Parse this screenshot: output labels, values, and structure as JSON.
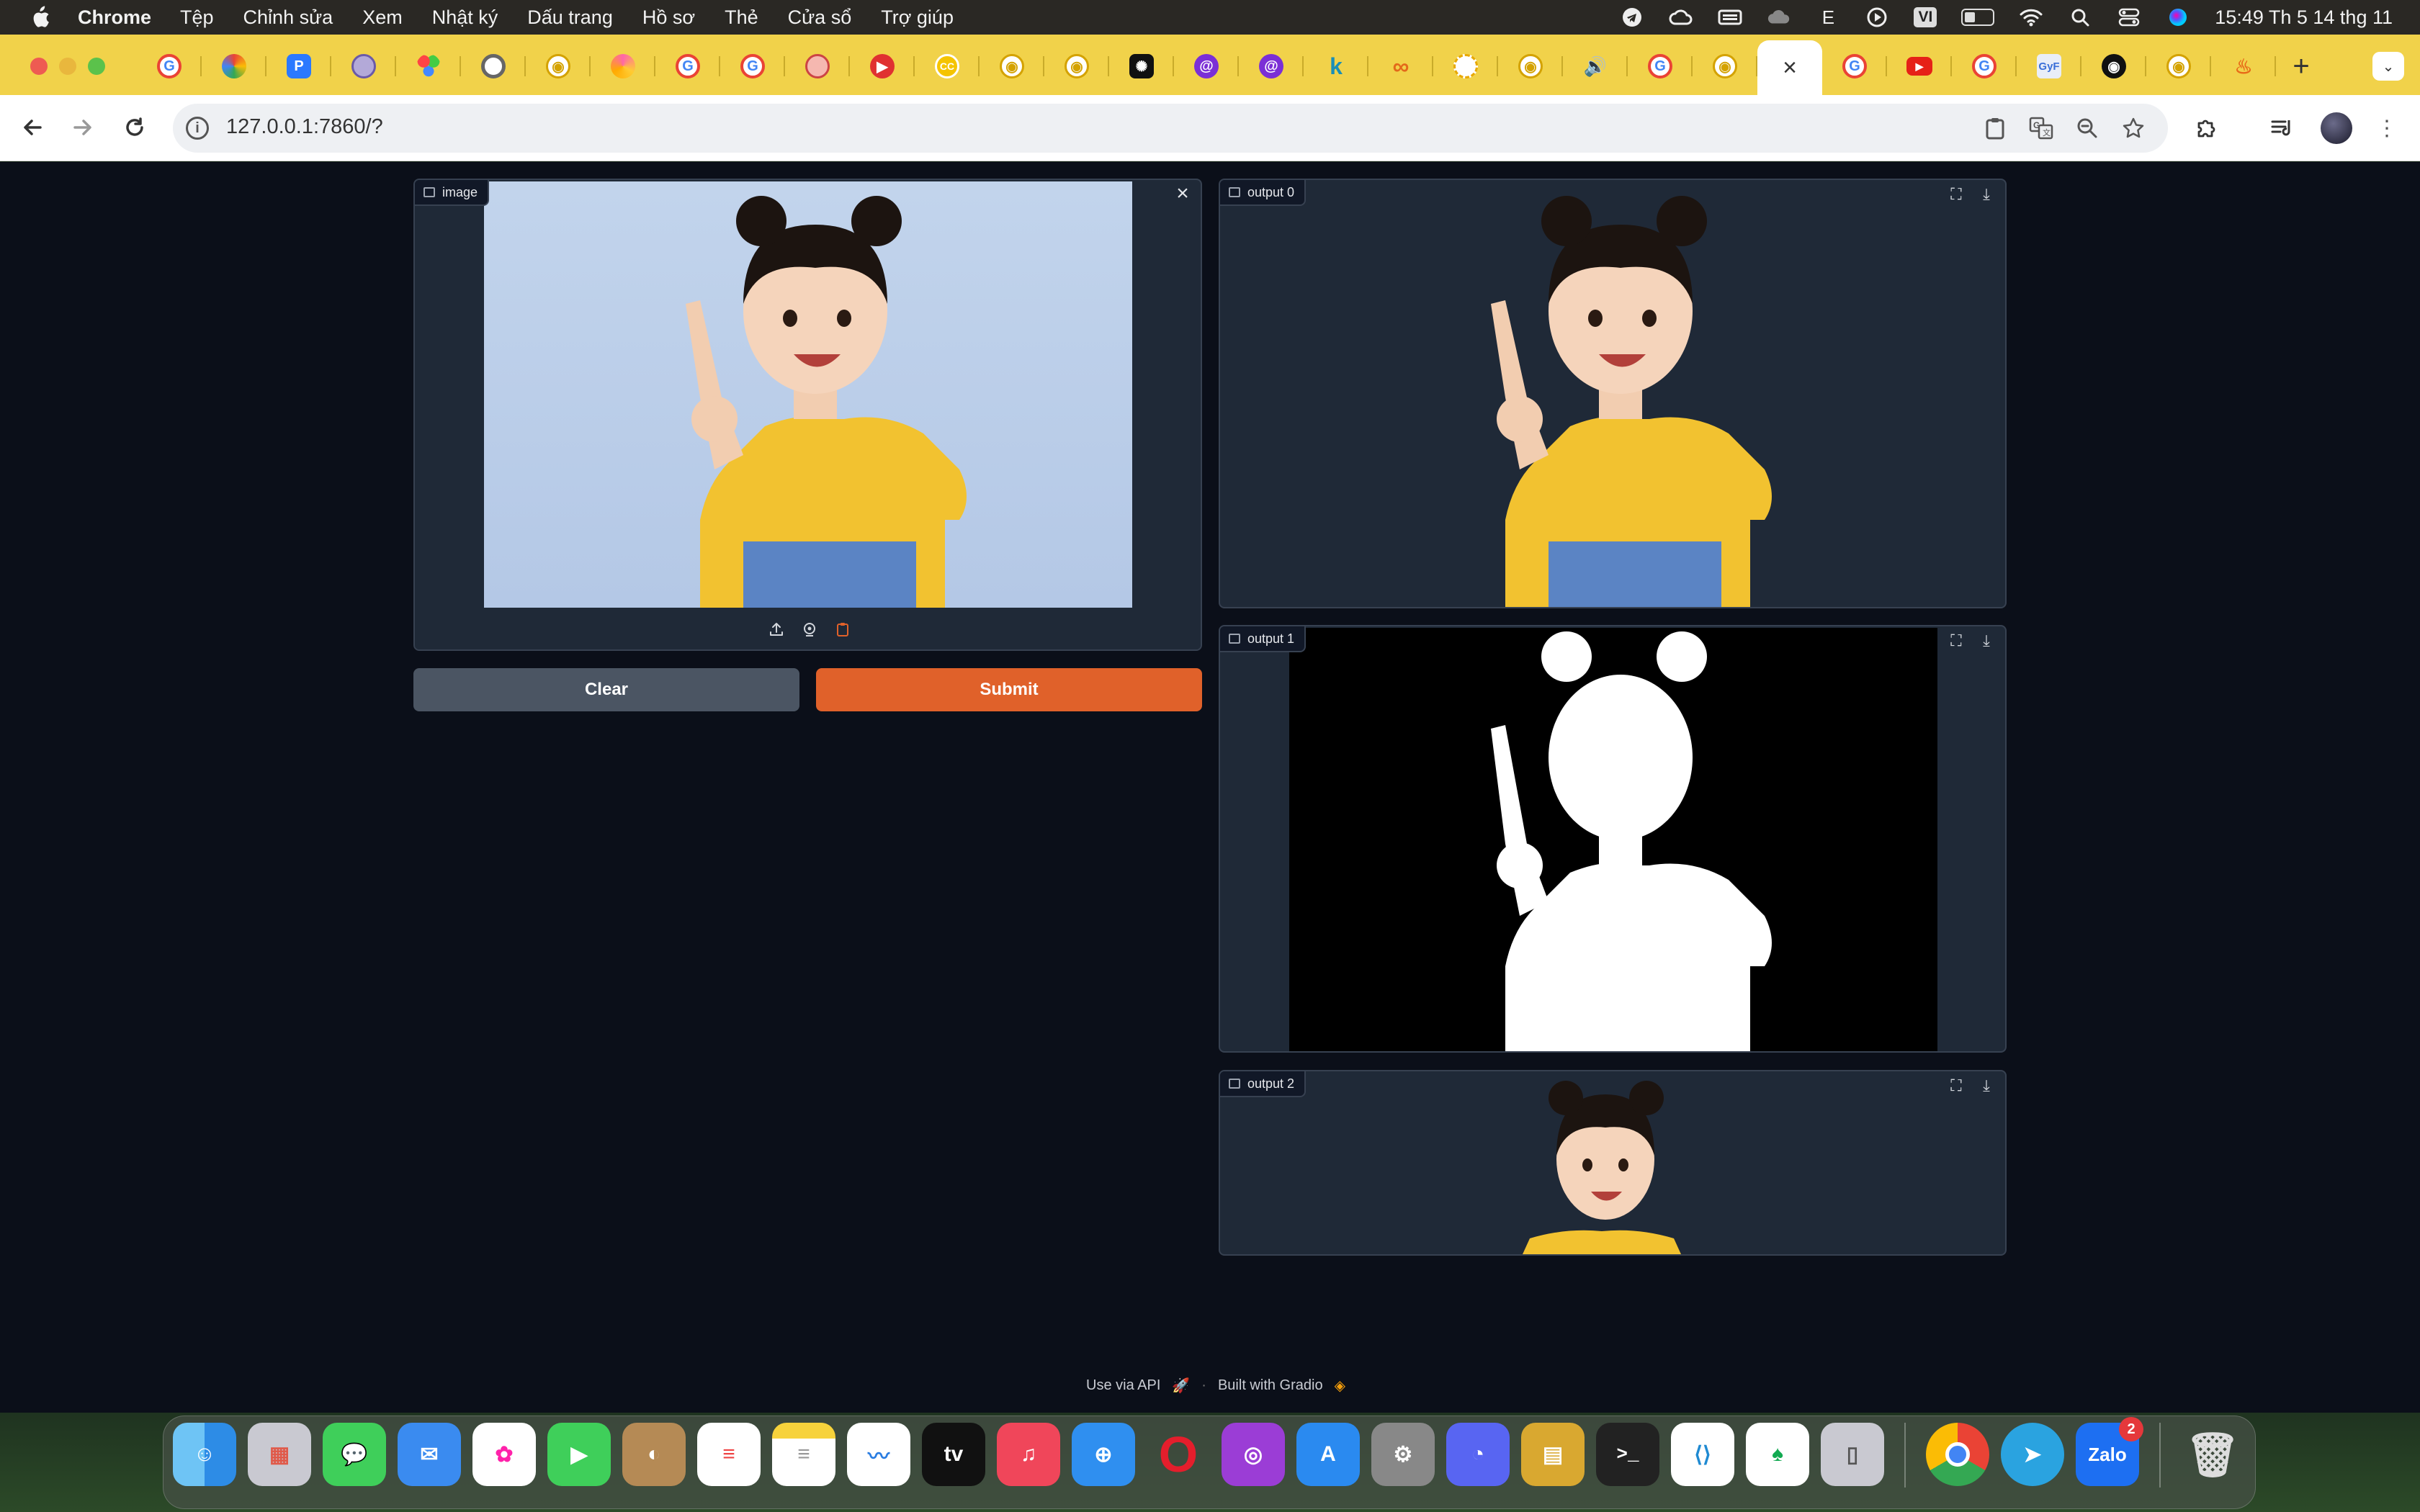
{
  "menubar": {
    "app_name": "Chrome",
    "items": [
      "Tệp",
      "Chỉnh sửa",
      "Xem",
      "Nhật ký",
      "Dấu trang",
      "Hồ sơ",
      "Thẻ",
      "Cửa sổ",
      "Trợ giúp"
    ],
    "input_source": "VI",
    "letter_icon": "E",
    "clock": "15:49 Th 5 14 thg 11"
  },
  "tabs": {
    "active_index": 25,
    "favicons": [
      "google",
      "pinwheel",
      "P",
      "gear",
      "colors",
      "record",
      "github",
      "pinwheel",
      "google",
      "google",
      "camera",
      "red-circle",
      "cc",
      "github",
      "github",
      "openai",
      "swirl",
      "swirl",
      "k",
      "infinity",
      "sun",
      "github",
      "speaker",
      "google",
      "github",
      "active",
      "google",
      "youtube",
      "google",
      "gyf",
      "github-dark",
      "github",
      "fire"
    ],
    "close_glyph": "×",
    "new_tab_glyph": "+"
  },
  "toolbar": {
    "url": "127.0.0.1:7860/?"
  },
  "gradio": {
    "input": {
      "label": "image"
    },
    "outputs": [
      {
        "label": "output 0"
      },
      {
        "label": "output 1"
      },
      {
        "label": "output 2"
      }
    ],
    "clear_label": "Clear",
    "submit_label": "Submit",
    "footer": {
      "api_label": "Use via API",
      "built_label": "Built with Gradio"
    }
  },
  "dock": {
    "apps": [
      "Finder",
      "Launchpad",
      "Messages",
      "Mail",
      "Photos",
      "FaceTime",
      "Contacts",
      "Reminders",
      "Notes",
      "Freeform",
      "Apple TV",
      "Music",
      "Safari",
      "Opera",
      "Podcasts",
      "App Store",
      "System Settings",
      "Discord",
      "Archive Utility",
      "Terminal",
      "VS Code",
      "MongoDB Compass",
      "iPhone Mirroring",
      "Chrome",
      "Telegram",
      "Zalo",
      "Trash"
    ],
    "zalo_badge": "2",
    "tv_label": "tv",
    "zalo_label": "Zalo"
  }
}
